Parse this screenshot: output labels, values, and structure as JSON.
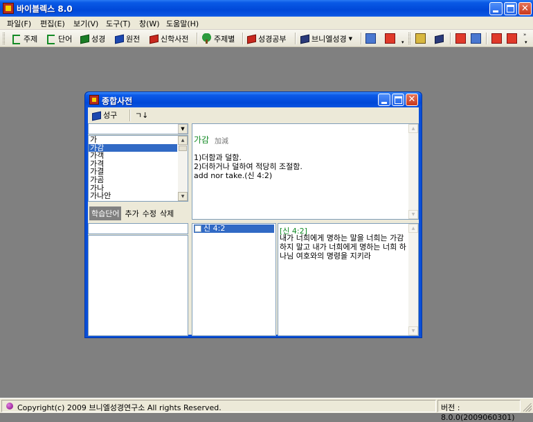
{
  "window": {
    "title": "바이블렉스 8.0"
  },
  "menu": [
    "파일(F)",
    "편집(E)",
    "보기(V)",
    "도구(T)",
    "창(W)",
    "도움말(H)"
  ],
  "toolbar": [
    {
      "label": "주제",
      "icon": "topic-icon"
    },
    {
      "label": "단어",
      "icon": "word-icon"
    },
    {
      "label": "성경",
      "icon": "bible-icon"
    },
    {
      "label": "원전",
      "icon": "original-text-icon"
    },
    {
      "label": "신학사전",
      "icon": "theology-dictionary-icon"
    },
    {
      "label": "주제별",
      "icon": "tree-icon"
    },
    {
      "label": "성경공부",
      "icon": "bible-study-icon"
    },
    {
      "label": "브니엘성경",
      "icon": "book-icon"
    }
  ],
  "dict": {
    "title": "종합사전",
    "toolbar": {
      "bible_label": "성구",
      "sort_label": "ㄱ↓"
    },
    "search_value": "",
    "words": [
      "가",
      "가감",
      "가객",
      "가격",
      "가결",
      "가곰",
      "가나",
      "가나안"
    ],
    "selected_word": "가감",
    "tabs": [
      "학습단어",
      "추가",
      "수정",
      "삭제"
    ],
    "active_tab": "학습단어",
    "definition": {
      "headword": "가감",
      "hanja": "加減",
      "lines": [
        "1)더함과 덜함.",
        "2)더하거나 덜하여 적당히 조절함.",
        "add nor take.(신 4:2)"
      ]
    },
    "references": [
      "신 4:2"
    ],
    "verse": {
      "ref": "[신 4:2]",
      "text": "내가 너희에게 명하는 말을 너희는 가감하지 말고 내가 너희에게 명하는 너희 하나님 여호와의 명령을 지키라"
    }
  },
  "status": {
    "copyright": "Copyright(c) 2009 브니엘성경연구소 All rights Reserved.",
    "version": "버전 : 8.0.0(2009060301)"
  }
}
